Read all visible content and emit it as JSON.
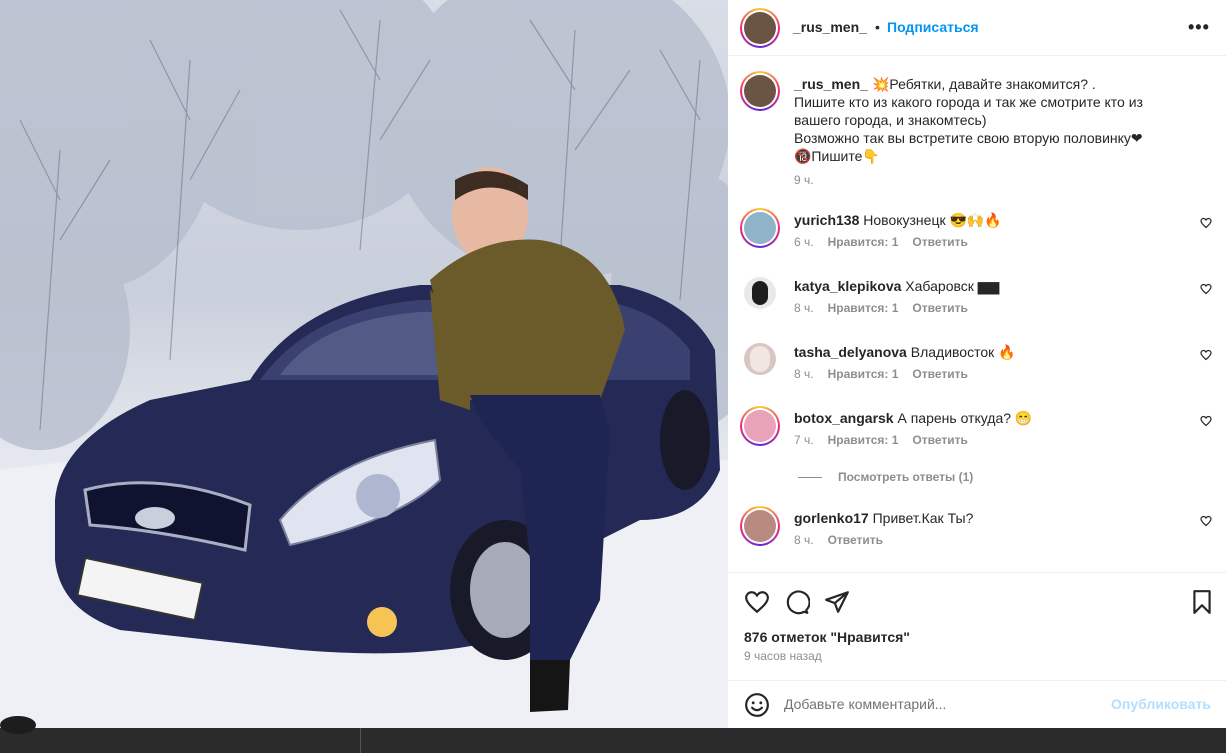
{
  "post": {
    "author": "_rus_men_",
    "separator": "•",
    "follow_label": "Подписаться",
    "more_label": "•••",
    "caption_lines": [
      "💥Ребятки, давайте знакомится? .",
      "Пишите кто из какого города и так же смотрите кто из",
      "вашего города, и знакомтесь)",
      "Возможно так вы встретите свою вторую половинку❤",
      "🔞Пишите👇"
    ],
    "caption_time": "9 ч.",
    "likes": "876 отметок \"Нравится\"",
    "posted_ago": "9 часов назад"
  },
  "comments": [
    {
      "user": "yurich138",
      "text": "Новокузнецк 😎🙌🔥",
      "time": "6 ч.",
      "likes": "Нравится: 1",
      "reply": "Ответить",
      "avatar_color": "#8fb3c9"
    },
    {
      "user": "katya_klepikova",
      "text": "Хабаровск ▆▆",
      "time": "8 ч.",
      "likes": "Нравится: 1",
      "reply": "Ответить",
      "avatar_color": "#3b3b3b"
    },
    {
      "user": "tasha_delyanova",
      "text": "Владивосток 🔥",
      "time": "8 ч.",
      "likes": "Нравится: 1",
      "reply": "Ответить",
      "avatar_color": "#d9c6c0"
    },
    {
      "user": "botox_angarsk",
      "text": "А парень откуда? 😁",
      "time": "7 ч.",
      "likes": "Нравится: 1",
      "reply": "Ответить",
      "avatar_color": "#e8a3b8"
    },
    {
      "user": "gorlenko17",
      "text": "Привет.Как Ты?",
      "time": "8 ч.",
      "likes": "",
      "reply": "Ответить",
      "avatar_color": "#b98a80"
    }
  ],
  "view_replies": "Посмотреть ответы (1)",
  "add_comment": {
    "placeholder": "Добавьте комментарий...",
    "post_label": "Опубликовать"
  },
  "icons": {
    "like": "heart-icon",
    "comment": "comment-bubble-icon",
    "share": "paper-plane-icon",
    "save": "bookmark-icon",
    "emoji": "smiley-icon",
    "more": "more-dots-icon"
  },
  "colors": {
    "accent": "#0095f6",
    "muted": "#8e8e8e",
    "post_disabled": "#b2dffc"
  }
}
